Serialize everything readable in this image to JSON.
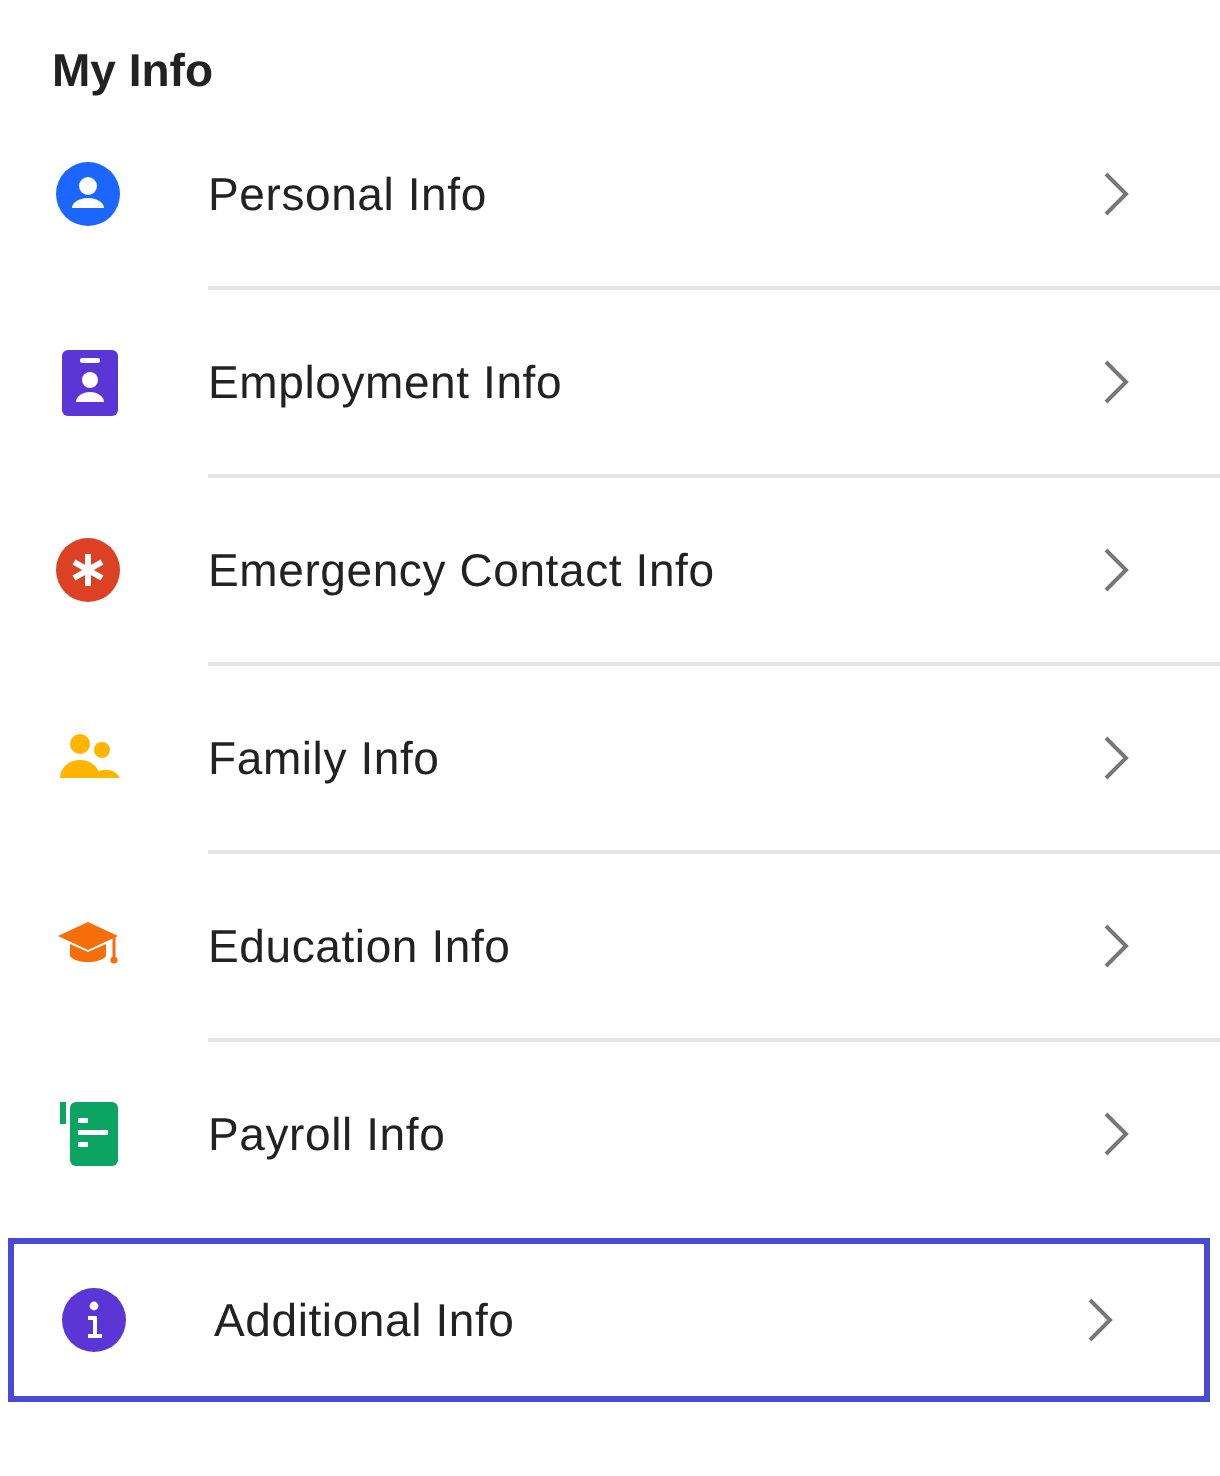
{
  "title": "My Info",
  "items": [
    {
      "label": "Personal Info",
      "kind": "person",
      "color": "#1a66ff",
      "selected": false
    },
    {
      "label": "Employment Info",
      "kind": "badge",
      "color": "#5b35d5",
      "selected": false
    },
    {
      "label": "Emergency Contact Info",
      "kind": "asterisk",
      "color": "#dc4123",
      "selected": false
    },
    {
      "label": "Family Info",
      "kind": "people",
      "color": "#ffb400",
      "selected": false
    },
    {
      "label": "Education Info",
      "kind": "cap",
      "color": "#f56e0a",
      "selected": false
    },
    {
      "label": "Payroll Info",
      "kind": "ledger",
      "color": "#0ba463",
      "selected": false
    },
    {
      "label": "Additional Info",
      "kind": "info",
      "color": "#5b35d5",
      "selected": true
    }
  ]
}
